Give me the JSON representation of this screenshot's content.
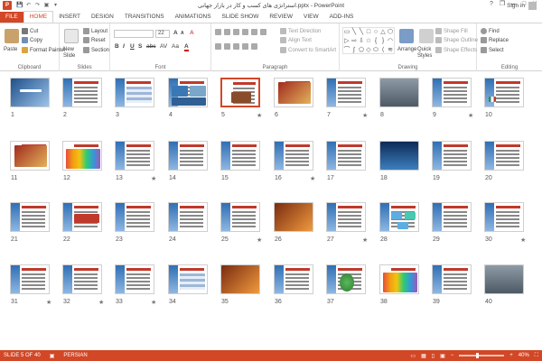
{
  "window": {
    "title": "استراتژی های کسب و کار در بازار جهانی.pptx - PowerPoint",
    "app_icon_letter": "P",
    "minimize": "—",
    "maximize": "□",
    "close": "✕",
    "help": "?",
    "restore": "❐"
  },
  "qat": {
    "save": "💾",
    "undo": "↶",
    "redo": "↷",
    "start": "▣",
    "more": "▾"
  },
  "tabs": [
    "FILE",
    "HOME",
    "INSERT",
    "DESIGN",
    "TRANSITIONS",
    "ANIMATIONS",
    "SLIDE SHOW",
    "REVIEW",
    "VIEW",
    "ADD-INS"
  ],
  "active_tab": "HOME",
  "sign_in": "Sign in",
  "ribbon": {
    "clipboard": {
      "label": "Clipboard",
      "paste": "Paste",
      "cut": "Cut",
      "copy": "Copy",
      "format_painter": "Format Painter"
    },
    "slides": {
      "label": "Slides",
      "new_slide": "New Slide",
      "layout": "Layout",
      "reset": "Reset",
      "section": "Section"
    },
    "font": {
      "label": "Font",
      "size": "22",
      "bold": "B",
      "italic": "I",
      "underline": "U",
      "strike": "S",
      "abc": "abc",
      "spacing": "AV",
      "case": "Aa",
      "color": "A",
      "grow": "A",
      "shrink": "A",
      "clear": "A"
    },
    "paragraph": {
      "label": "Paragraph",
      "text_direction": "Text Direction",
      "align_text": "Align Text",
      "smartart": "Convert to SmartArt"
    },
    "drawing": {
      "label": "Drawing",
      "arrange": "Arrange",
      "quick_styles": "Quick Styles",
      "shape_fill": "Shape Fill",
      "shape_outline": "Shape Outline",
      "shape_effects": "Shape Effects"
    },
    "editing": {
      "label": "Editing",
      "find": "Find",
      "replace": "Replace",
      "select": "Select"
    }
  },
  "shape_glyphs": [
    "▭",
    "╲",
    "╲",
    "□",
    "○",
    "△",
    "⬡",
    "▷",
    "⇨",
    "⇩",
    "☆",
    "{",
    "}",
    "◠",
    "⌒",
    "∫",
    "⬠",
    "◇",
    "⬭",
    "⟨",
    "≋"
  ],
  "slides": [
    {
      "n": "1",
      "star": false,
      "type": "title"
    },
    {
      "n": "2",
      "star": false,
      "type": "text"
    },
    {
      "n": "3",
      "star": false,
      "type": "table"
    },
    {
      "n": "4",
      "star": false,
      "type": "photos"
    },
    {
      "n": "5",
      "star": true,
      "type": "selected"
    },
    {
      "n": "6",
      "star": false,
      "type": "photo-red"
    },
    {
      "n": "7",
      "star": true,
      "type": "text"
    },
    {
      "n": "8",
      "star": false,
      "type": "photo-gray"
    },
    {
      "n": "9",
      "star": true,
      "type": "text"
    },
    {
      "n": "10",
      "star": false,
      "type": "flag"
    },
    {
      "n": "11",
      "star": false,
      "type": "photo-red"
    },
    {
      "n": "12",
      "star": false,
      "type": "hands"
    },
    {
      "n": "13",
      "star": true,
      "type": "text"
    },
    {
      "n": "14",
      "star": false,
      "type": "text"
    },
    {
      "n": "15",
      "star": false,
      "type": "text"
    },
    {
      "n": "16",
      "star": true,
      "type": "text"
    },
    {
      "n": "17",
      "star": false,
      "type": "text"
    },
    {
      "n": "18",
      "star": false,
      "type": "photo-blue"
    },
    {
      "n": "19",
      "star": false,
      "type": "text"
    },
    {
      "n": "20",
      "star": false,
      "type": "text"
    },
    {
      "n": "21",
      "star": false,
      "type": "text"
    },
    {
      "n": "22",
      "star": false,
      "type": "red-block"
    },
    {
      "n": "23",
      "star": false,
      "type": "text"
    },
    {
      "n": "24",
      "star": false,
      "type": "text"
    },
    {
      "n": "25",
      "star": true,
      "type": "text"
    },
    {
      "n": "26",
      "star": false,
      "type": "photo-orange"
    },
    {
      "n": "27",
      "star": true,
      "type": "text"
    },
    {
      "n": "28",
      "star": false,
      "type": "diagram"
    },
    {
      "n": "29",
      "star": false,
      "type": "text"
    },
    {
      "n": "30",
      "star": true,
      "type": "text"
    },
    {
      "n": "31",
      "star": true,
      "type": "text"
    },
    {
      "n": "32",
      "star": true,
      "type": "text"
    },
    {
      "n": "33",
      "star": true,
      "type": "text"
    },
    {
      "n": "34",
      "star": false,
      "type": "table"
    },
    {
      "n": "35",
      "star": false,
      "type": "photo-orange"
    },
    {
      "n": "36",
      "star": false,
      "type": "text"
    },
    {
      "n": "37",
      "star": false,
      "type": "plant"
    },
    {
      "n": "38",
      "star": false,
      "type": "hands"
    },
    {
      "n": "39",
      "star": false,
      "type": "text"
    },
    {
      "n": "40",
      "star": false,
      "type": "photo-gray"
    }
  ],
  "status": {
    "slide_count": "SLIDE 5 OF 40",
    "language": "PERSIAN",
    "zoom": "40%",
    "zoom_level": 0.4
  },
  "colors": {
    "accent": "#d24726"
  }
}
